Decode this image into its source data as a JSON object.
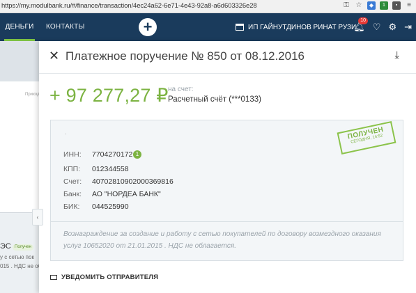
{
  "browser": {
    "url": "https://my.modulbank.ru/#/finance/transaction/4ec24a62-6e71-4e43-92a8-a6d603326e28",
    "ext_badge": "1"
  },
  "nav": {
    "tab_money": "ДЕНЬГИ",
    "tab_contacts": "КОНТАКТЫ",
    "add_label": "+",
    "company": "ИП ГАЙНУТДИНОВ РИНАТ РУЗИ.",
    "notifications_count": "10"
  },
  "background": {
    "card_label": "Приход",
    "item_title": "ЭС",
    "item_badge": "Получен",
    "item_sub1": "у с сетью пок",
    "item_sub2": "015 . НДС не об"
  },
  "modal": {
    "title": "Платежное поручение № 850 от 08.12.2016",
    "amount": "+ 97 277,27 ₽",
    "account_label": "на счет:",
    "account_name": "Расчетный счёт (***0133)",
    "stamp": {
      "line1": "ПОЛУЧЕН",
      "line2": "СЕГОДНЯ, 14:52"
    },
    "fields": [
      {
        "label": "ИНН:",
        "value": "7704270172"
      },
      {
        "label": "КПП:",
        "value": "012344558"
      },
      {
        "label": "Счет:",
        "value": "40702810902000369816"
      },
      {
        "label": "Банк:",
        "value": "АО \"НОРДЕА БАНК\""
      },
      {
        "label": "БИК:",
        "value": "044525990"
      }
    ],
    "inn_verified_badge": "1",
    "purpose": "Вознаграждение за создание и работу с сетью покупателей по договору возмездного оказания услуг 10652020 от 21.01.2015 . НДС не облагается.",
    "notify_label": "УВЕДОМИТЬ ОТПРАВИТЕЛЯ"
  },
  "colors": {
    "nav_bg": "#1a3b5c",
    "accent_green": "#7cb342",
    "panel_bg": "#f3f6f8"
  }
}
